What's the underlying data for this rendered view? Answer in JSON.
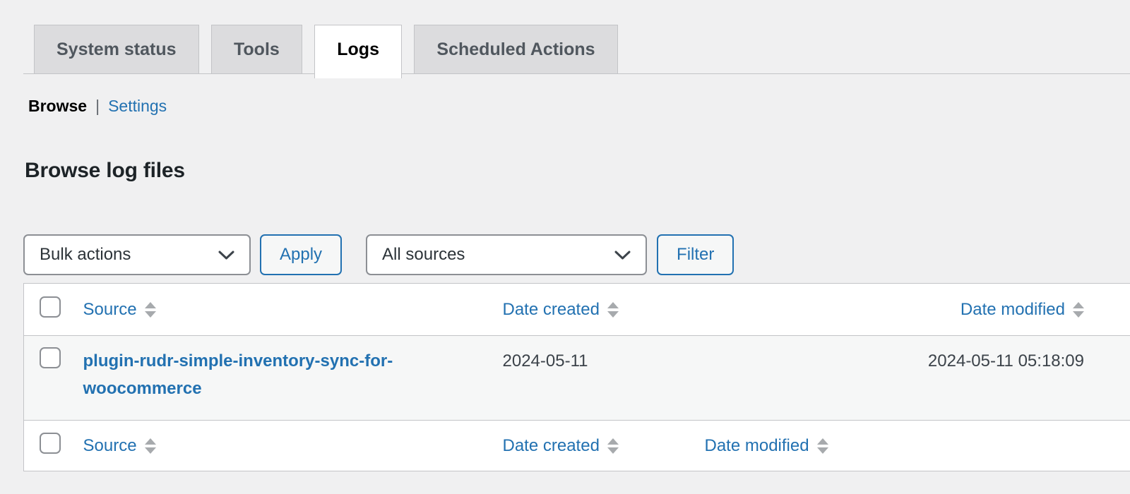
{
  "tabs": [
    {
      "label": "System status",
      "active": false
    },
    {
      "label": "Tools",
      "active": false
    },
    {
      "label": "Logs",
      "active": true
    },
    {
      "label": "Scheduled Actions",
      "active": false
    }
  ],
  "subnav": {
    "browse": "Browse",
    "separator": "|",
    "settings": "Settings"
  },
  "heading": "Browse log files",
  "toolbar": {
    "bulk_actions_value": "Bulk actions",
    "apply_label": "Apply",
    "sources_value": "All sources",
    "filter_label": "Filter"
  },
  "table": {
    "columns": [
      "Source",
      "Date created",
      "Date modified"
    ],
    "rows": [
      {
        "source": "plugin-rudr-simple-inventory-sync-for-woocommerce",
        "date_created": "2024-05-11",
        "date_modified": "2024-05-11 05:18:09"
      }
    ]
  },
  "icons": {
    "select_caret": "chevron-down",
    "column_sort": "sort-up-down-triangles"
  },
  "colors": {
    "accent_blue": "#2271b1",
    "page_background": "#f0f0f1",
    "tab_background": "#dcdcde",
    "border": "#c3c4c7",
    "input_border": "#8c8f94",
    "heading_text": "#1d2327",
    "body_text": "#3c434a",
    "sort_icon": "#a7aaad",
    "row_stripe": "#f6f7f7"
  }
}
